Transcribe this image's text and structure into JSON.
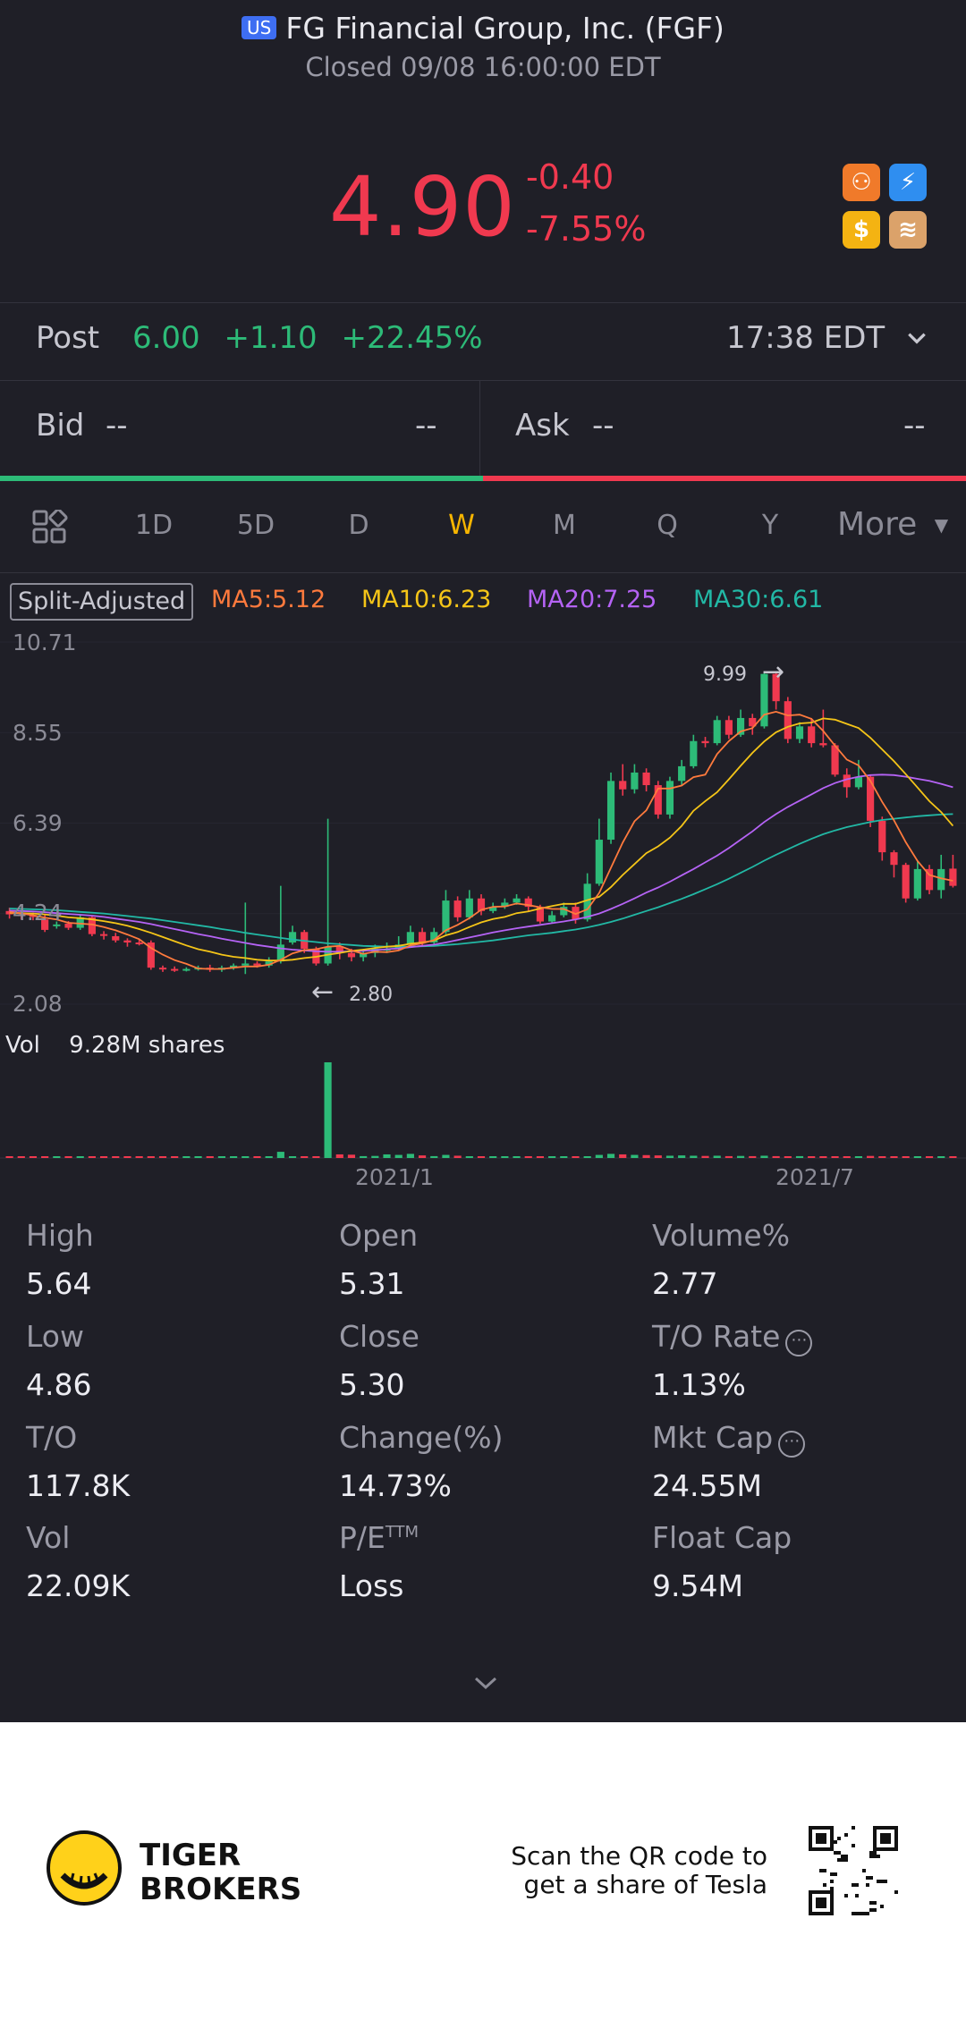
{
  "header": {
    "market_badge": "US",
    "title": "FG Financial Group, Inc. (FGF)",
    "status": "Closed 09/08 16:00:00 EDT",
    "price": "4.90",
    "change": "-0.40",
    "change_pct": "-7.55%",
    "colors": {
      "down": "#f0394f",
      "up": "#2dbb78",
      "active": "#f7b500"
    }
  },
  "post": {
    "label": "Post",
    "price": "6.00",
    "change": "+1.10",
    "change_pct": "+22.45%",
    "time": "17:38 EDT"
  },
  "quote": {
    "bid_label": "Bid",
    "bid_price": "--",
    "bid_size": "--",
    "ask_label": "Ask",
    "ask_price": "--",
    "ask_size": "--"
  },
  "tabs": {
    "items": [
      "1D",
      "5D",
      "D",
      "W",
      "M",
      "Q",
      "Y"
    ],
    "active": "W",
    "more": "More"
  },
  "indicators": {
    "split": "Split-Adjusted",
    "ma5": "MA5:5.12",
    "ma10": "MA10:6.23",
    "ma20": "MA20:7.25",
    "ma30": "MA30:6.61",
    "colors": {
      "ma5": "#ff7a3d",
      "ma10": "#f5c518",
      "ma20": "#b563f5",
      "ma30": "#22b8a5"
    }
  },
  "chart_data": {
    "type": "candlestick",
    "interval": "W",
    "y_ticks": [
      "10.71",
      "8.55",
      "6.39",
      "4.24",
      "2.08"
    ],
    "ylim": [
      2.08,
      10.71
    ],
    "x_ticks": [
      "2021/1",
      "2021/7"
    ],
    "high_marker": "9.99",
    "low_marker": "2.80",
    "volume_label": "Vol",
    "volume_value": "9.28M shares",
    "candles": [
      [
        4.3,
        4.22,
        4.38,
        4.12
      ],
      [
        4.22,
        4.2,
        4.3,
        4.1
      ],
      [
        4.2,
        4.18,
        4.26,
        4.08
      ],
      [
        4.1,
        3.85,
        4.2,
        3.8
      ],
      [
        3.95,
        3.98,
        4.05,
        3.88
      ],
      [
        4.0,
        3.9,
        4.06,
        3.85
      ],
      [
        3.9,
        4.15,
        4.22,
        3.85
      ],
      [
        4.15,
        3.75,
        4.2,
        3.7
      ],
      [
        3.75,
        3.72,
        3.82,
        3.62
      ],
      [
        3.7,
        3.6,
        3.78,
        3.55
      ],
      [
        3.6,
        3.55,
        3.65,
        3.45
      ],
      [
        3.55,
        3.52,
        3.62,
        3.48
      ],
      [
        3.55,
        2.95,
        3.6,
        2.9
      ],
      [
        2.95,
        2.92,
        3.0,
        2.85
      ],
      [
        2.92,
        2.9,
        2.98,
        2.85
      ],
      [
        2.9,
        2.92,
        2.96,
        2.86
      ],
      [
        2.92,
        2.95,
        3.0,
        2.88
      ],
      [
        2.95,
        2.9,
        3.02,
        2.85
      ],
      [
        2.9,
        2.95,
        3.0,
        2.85
      ],
      [
        2.95,
        3.0,
        3.05,
        2.9
      ],
      [
        3.0,
        3.05,
        4.5,
        2.8
      ],
      [
        3.05,
        3.0,
        3.1,
        2.95
      ],
      [
        3.0,
        3.1,
        3.2,
        2.95
      ],
      [
        3.1,
        3.5,
        4.9,
        3.05
      ],
      [
        3.55,
        3.8,
        3.95,
        3.5
      ],
      [
        3.8,
        3.4,
        3.85,
        3.3
      ],
      [
        3.4,
        3.05,
        3.45,
        3.0
      ],
      [
        3.05,
        3.45,
        6.5,
        3.0
      ],
      [
        3.45,
        3.3,
        3.55,
        3.15
      ],
      [
        3.3,
        3.2,
        3.4,
        3.1
      ],
      [
        3.2,
        3.3,
        3.4,
        3.1
      ],
      [
        3.3,
        3.4,
        3.5,
        3.2
      ],
      [
        3.4,
        3.4,
        3.55,
        3.3
      ],
      [
        3.4,
        3.5,
        3.7,
        3.35
      ],
      [
        3.5,
        3.8,
        3.95,
        3.45
      ],
      [
        3.8,
        3.55,
        3.9,
        3.45
      ],
      [
        3.55,
        3.8,
        3.9,
        3.5
      ],
      [
        3.8,
        4.55,
        4.8,
        3.75
      ],
      [
        4.55,
        4.15,
        4.65,
        4.05
      ],
      [
        4.15,
        4.6,
        4.8,
        4.1
      ],
      [
        4.6,
        4.3,
        4.7,
        4.2
      ],
      [
        4.3,
        4.4,
        4.5,
        4.25
      ],
      [
        4.4,
        4.5,
        4.6,
        4.35
      ],
      [
        4.5,
        4.6,
        4.7,
        4.45
      ],
      [
        4.6,
        4.4,
        4.65,
        4.3
      ],
      [
        4.4,
        4.05,
        4.45,
        4.0
      ],
      [
        4.05,
        4.2,
        4.3,
        4.0
      ],
      [
        4.2,
        4.4,
        4.5,
        4.15
      ],
      [
        4.4,
        4.1,
        4.5,
        4.0
      ],
      [
        4.1,
        4.95,
        5.2,
        4.05
      ],
      [
        4.95,
        6.0,
        6.5,
        4.9
      ],
      [
        6.0,
        7.4,
        7.6,
        5.9
      ],
      [
        7.4,
        7.2,
        7.8,
        7.05
      ],
      [
        7.2,
        7.6,
        7.8,
        7.1
      ],
      [
        7.6,
        7.3,
        7.7,
        7.15
      ],
      [
        7.3,
        6.6,
        7.4,
        6.5
      ],
      [
        6.6,
        7.4,
        7.5,
        6.5
      ],
      [
        7.4,
        7.75,
        7.9,
        7.3
      ],
      [
        7.75,
        8.35,
        8.5,
        7.7
      ],
      [
        8.35,
        8.3,
        8.45,
        8.2
      ],
      [
        8.3,
        8.85,
        8.95,
        8.25
      ],
      [
        8.85,
        8.5,
        8.95,
        8.4
      ],
      [
        8.5,
        8.9,
        9.1,
        8.45
      ],
      [
        8.9,
        8.7,
        9.0,
        8.5
      ],
      [
        8.7,
        9.95,
        9.99,
        8.65
      ],
      [
        9.95,
        9.3,
        9.99,
        9.1
      ],
      [
        9.3,
        8.4,
        9.4,
        8.3
      ],
      [
        8.4,
        8.7,
        8.8,
        8.3
      ],
      [
        8.7,
        8.3,
        8.9,
        8.2
      ],
      [
        8.3,
        8.25,
        9.1,
        8.2
      ],
      [
        8.25,
        7.55,
        8.3,
        7.5
      ],
      [
        7.55,
        7.25,
        7.7,
        7.0
      ],
      [
        7.25,
        7.5,
        7.9,
        7.2
      ],
      [
        7.5,
        6.45,
        7.55,
        6.3
      ],
      [
        6.45,
        5.7,
        6.55,
        5.5
      ],
      [
        5.7,
        5.4,
        5.75,
        5.1
      ],
      [
        5.4,
        4.6,
        5.45,
        4.5
      ],
      [
        4.6,
        5.3,
        5.5,
        4.55
      ],
      [
        5.3,
        4.8,
        5.4,
        4.7
      ],
      [
        4.8,
        5.3,
        5.64,
        4.6
      ],
      [
        5.31,
        4.9,
        5.64,
        4.86
      ]
    ],
    "ma5": [
      4.28,
      4.24,
      4.2,
      4.14,
      4.1,
      4.02,
      4.0,
      3.98,
      3.92,
      3.84,
      3.74,
      3.63,
      3.42,
      3.26,
      3.13,
      3.04,
      2.93,
      2.92,
      2.92,
      2.95,
      2.98,
      2.98,
      3.02,
      3.14,
      3.29,
      3.37,
      3.39,
      3.45,
      3.47,
      3.36,
      3.28,
      3.33,
      3.32,
      3.36,
      3.48,
      3.53,
      3.61,
      3.84,
      3.97,
      4.13,
      4.33,
      4.4,
      4.41,
      4.48,
      4.44,
      4.39,
      4.35,
      4.35,
      4.23,
      4.34,
      4.73,
      5.33,
      5.93,
      6.44,
      6.7,
      7.22,
      7.22,
      7.29,
      7.49,
      7.55,
      8.04,
      8.35,
      8.58,
      8.66,
      8.98,
      9.05,
      8.96,
      8.98,
      8.88,
      8.59,
      8.24,
      7.91,
      7.77,
      7.4,
      6.9,
      6.46,
      5.94,
      5.49,
      5.16,
      5.08,
      5.02
    ],
    "ma10": [
      4.26,
      4.25,
      4.24,
      4.22,
      4.19,
      4.15,
      4.13,
      4.1,
      4.06,
      4.01,
      3.95,
      3.87,
      3.78,
      3.68,
      3.58,
      3.48,
      3.39,
      3.33,
      3.26,
      3.21,
      3.18,
      3.14,
      3.12,
      3.12,
      3.14,
      3.18,
      3.21,
      3.26,
      3.3,
      3.35,
      3.38,
      3.42,
      3.45,
      3.47,
      3.52,
      3.55,
      3.6,
      3.72,
      3.8,
      3.92,
      4.03,
      4.11,
      4.16,
      4.25,
      4.29,
      4.36,
      4.42,
      4.47,
      4.47,
      4.56,
      4.64,
      4.87,
      5.16,
      5.42,
      5.68,
      5.84,
      6.05,
      6.33,
      6.69,
      6.92,
      7.13,
      7.44,
      7.76,
      8.07,
      8.34,
      8.56,
      8.69,
      8.77,
      8.79,
      8.89,
      8.86,
      8.76,
      8.66,
      8.43,
      8.15,
      7.87,
      7.56,
      7.24,
      6.92,
      6.66,
      6.33
    ],
    "ma20": [
      4.31,
      4.3,
      4.29,
      4.27,
      4.25,
      4.23,
      4.21,
      4.19,
      4.16,
      4.12,
      4.08,
      4.04,
      3.99,
      3.93,
      3.87,
      3.81,
      3.75,
      3.7,
      3.64,
      3.59,
      3.54,
      3.49,
      3.45,
      3.41,
      3.38,
      3.36,
      3.34,
      3.33,
      3.33,
      3.34,
      3.35,
      3.37,
      3.39,
      3.41,
      3.44,
      3.47,
      3.5,
      3.55,
      3.61,
      3.67,
      3.73,
      3.79,
      3.84,
      3.89,
      3.93,
      3.97,
      4.01,
      4.05,
      4.1,
      4.16,
      4.24,
      4.35,
      4.47,
      4.6,
      4.74,
      4.86,
      5.0,
      5.15,
      5.3,
      5.46,
      5.62,
      5.8,
      6.0,
      6.2,
      6.42,
      6.61,
      6.78,
      6.93,
      7.08,
      7.23,
      7.35,
      7.44,
      7.5,
      7.54,
      7.55,
      7.54,
      7.5,
      7.45,
      7.4,
      7.33,
      7.25
    ],
    "ma30": [
      4.36,
      4.35,
      4.34,
      4.33,
      4.32,
      4.3,
      4.28,
      4.26,
      4.24,
      4.21,
      4.18,
      4.15,
      4.12,
      4.08,
      4.04,
      4.0,
      3.96,
      3.92,
      3.87,
      3.83,
      3.78,
      3.74,
      3.7,
      3.66,
      3.62,
      3.59,
      3.56,
      3.53,
      3.51,
      3.49,
      3.47,
      3.46,
      3.45,
      3.45,
      3.45,
      3.46,
      3.47,
      3.49,
      3.51,
      3.54,
      3.57,
      3.6,
      3.64,
      3.68,
      3.72,
      3.75,
      3.78,
      3.82,
      3.86,
      3.91,
      3.97,
      4.04,
      4.12,
      4.21,
      4.3,
      4.39,
      4.49,
      4.59,
      4.7,
      4.82,
      4.94,
      5.07,
      5.21,
      5.35,
      5.5,
      5.64,
      5.77,
      5.9,
      6.02,
      6.13,
      6.22,
      6.3,
      6.36,
      6.42,
      6.47,
      6.5,
      6.53,
      6.56,
      6.58,
      6.6,
      6.61
    ],
    "volumes": [
      0.05,
      0.04,
      0.06,
      0.07,
      0.05,
      0.05,
      0.06,
      0.05,
      0.05,
      0.06,
      0.05,
      0.05,
      0.09,
      0.06,
      0.05,
      0.05,
      0.1,
      0.14,
      0.07,
      0.09,
      0.1,
      0.08,
      0.12,
      0.6,
      0.14,
      0.09,
      0.13,
      9.28,
      0.35,
      0.32,
      0.18,
      0.2,
      0.35,
      0.3,
      0.4,
      0.25,
      0.18,
      0.3,
      0.22,
      0.15,
      0.12,
      0.12,
      0.1,
      0.09,
      0.1,
      0.12,
      0.1,
      0.11,
      0.12,
      0.15,
      0.3,
      0.4,
      0.35,
      0.3,
      0.28,
      0.25,
      0.22,
      0.25,
      0.22,
      0.2,
      0.22,
      0.18,
      0.2,
      0.18,
      0.22,
      0.18,
      0.17,
      0.18,
      0.16,
      0.15,
      0.14,
      0.15,
      0.16,
      0.2,
      0.15,
      0.14,
      0.16,
      0.12,
      0.14,
      0.13,
      0.12
    ]
  },
  "stats": [
    {
      "label": "High",
      "value": "5.64"
    },
    {
      "label": "Open",
      "value": "5.31"
    },
    {
      "label": "Volume%",
      "value": "2.77"
    },
    {
      "label": "Low",
      "value": "4.86"
    },
    {
      "label": "Close",
      "value": "5.30"
    },
    {
      "label": "T/O Rate",
      "value": "1.13%"
    },
    {
      "label": "T/O",
      "value": "117.8K"
    },
    {
      "label": "Change(%)",
      "value": "14.73%"
    },
    {
      "label": "Mkt Cap",
      "value": "24.55M"
    },
    {
      "label": "Vol",
      "value": "22.09K"
    },
    {
      "label": "P/E",
      "value": "Loss"
    },
    {
      "label": "Float Cap",
      "value": "9.54M"
    }
  ],
  "pe_suffix": "TTM",
  "footer": {
    "brand_line1": "TIGER",
    "brand_line2": "BROKERS",
    "qr_line1": "Scan the QR code to",
    "qr_line2": "get a share of Tesla"
  }
}
